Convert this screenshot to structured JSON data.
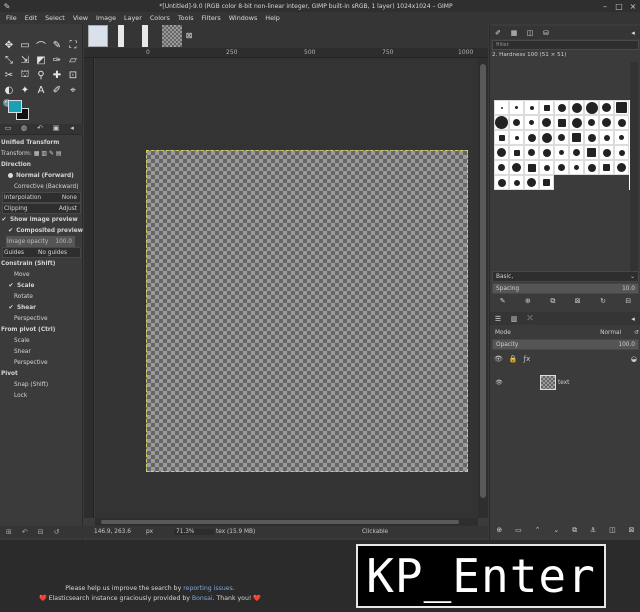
{
  "window": {
    "title": "*[Untitled]-9.0 (RGB color 8-bit non-linear integer, GIMP built-in sRGB, 1 layer) 1024x1024 – GIMP",
    "controls": [
      "–",
      "□",
      "×"
    ]
  },
  "menu": [
    "File",
    "Edit",
    "Select",
    "View",
    "Image",
    "Layer",
    "Colors",
    "Tools",
    "Filters",
    "Windows",
    "Help"
  ],
  "tools": [
    "✥",
    "▭",
    "⌒",
    "✎",
    "⛶",
    "⤡",
    "⇲",
    "◩",
    "✑",
    "▱",
    "✂",
    "⛫",
    "⚲",
    "✚",
    "⊡",
    "◐",
    "✦",
    "A",
    "✐",
    "⌖",
    "🔍"
  ],
  "colors": {
    "foreground": "#1aa0b8",
    "background": "#111111"
  },
  "tool_options": {
    "title": "Unified Transform",
    "transform_label": "Transform:",
    "direction_label": "Direction",
    "normal": "Normal (Forward)",
    "corrective": "Corrective (Backward)",
    "interpolation_label": "Interpolation",
    "interpolation_value": "None",
    "clipping_label": "Clipping",
    "clipping_value": "Adjust",
    "show_preview": "Show image preview",
    "composited_preview": "Composited preview",
    "image_opacity_label": "Image opacity",
    "image_opacity_value": "100.0",
    "guides_label": "Guides",
    "guides_value": "No guides",
    "constrain_label": "Constrain (Shift)",
    "move": "Move",
    "scale": "Scale",
    "rotate": "Rotate",
    "shear": "Shear",
    "perspective": "Perspective",
    "from_pivot_label": "From pivot  (Ctrl)",
    "pivot_scale": "Scale",
    "pivot_shear": "Shear",
    "pivot_perspective": "Perspective",
    "pivot_label": "Pivot",
    "snap": "Snap (Shift)",
    "lock": "Lock"
  },
  "ruler": {
    "h_labels": [
      "0",
      "250",
      "500",
      "750",
      "1000"
    ]
  },
  "status": {
    "coords": "146.9, 263.6",
    "unit": "px",
    "zoom": "71.3%",
    "info": "tex (15.9 MB)",
    "message": "Clickable"
  },
  "brushes": {
    "filter_placeholder": "filter",
    "selected_name": "2. Hardness 100 (51 × 51)",
    "preset": "Basic,",
    "spacing_label": "Spacing",
    "spacing_value": "10.0"
  },
  "layers": {
    "mode_label": "Mode",
    "mode_value": "Normal",
    "opacity_label": "Opacity",
    "opacity_value": "100.0",
    "lock_label": "Lock:",
    "items": [
      {
        "name": "text"
      }
    ]
  },
  "footer": {
    "line1_pre": "Please help us improve the search by ",
    "line1_link": "reporting issues",
    "line1_post": ".",
    "line2_pre": "❤️ Elasticsearch instance graciously provided by ",
    "line2_link": "Bonsai",
    "line2_post": ". Thank you! ❤️"
  },
  "keypress": "KP_Enter"
}
